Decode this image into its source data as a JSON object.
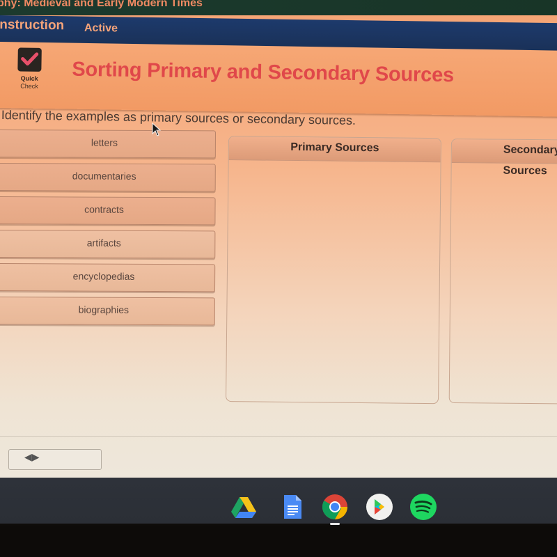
{
  "course": {
    "title": "phy: Medieval and Early Modern Times"
  },
  "nav": {
    "tabs": [
      {
        "label": "Instruction"
      },
      {
        "label": "Active"
      }
    ]
  },
  "header": {
    "badge_line1": "Quick",
    "badge_line2": "Check",
    "title": "Sorting Primary and Secondary Sources",
    "title_color": "#e0484a"
  },
  "prompt": "Identify the examples as primary sources or secondary sources.",
  "items": [
    {
      "label": "letters"
    },
    {
      "label": "documentaries"
    },
    {
      "label": "contracts"
    },
    {
      "label": "artifacts"
    },
    {
      "label": "encyclopedias"
    },
    {
      "label": "biographies"
    }
  ],
  "bins": [
    {
      "label": "Primary Sources"
    },
    {
      "label": "Secondary Sources"
    }
  ],
  "taskbar": {
    "apps": [
      {
        "name": "Google Drive",
        "icon": "drive-icon"
      },
      {
        "name": "Google Docs",
        "icon": "docs-icon"
      },
      {
        "name": "Chrome",
        "icon": "chrome-icon",
        "running": true
      },
      {
        "name": "Play Store",
        "icon": "play-store-icon"
      },
      {
        "name": "Spotify",
        "icon": "spotify-icon"
      }
    ]
  }
}
